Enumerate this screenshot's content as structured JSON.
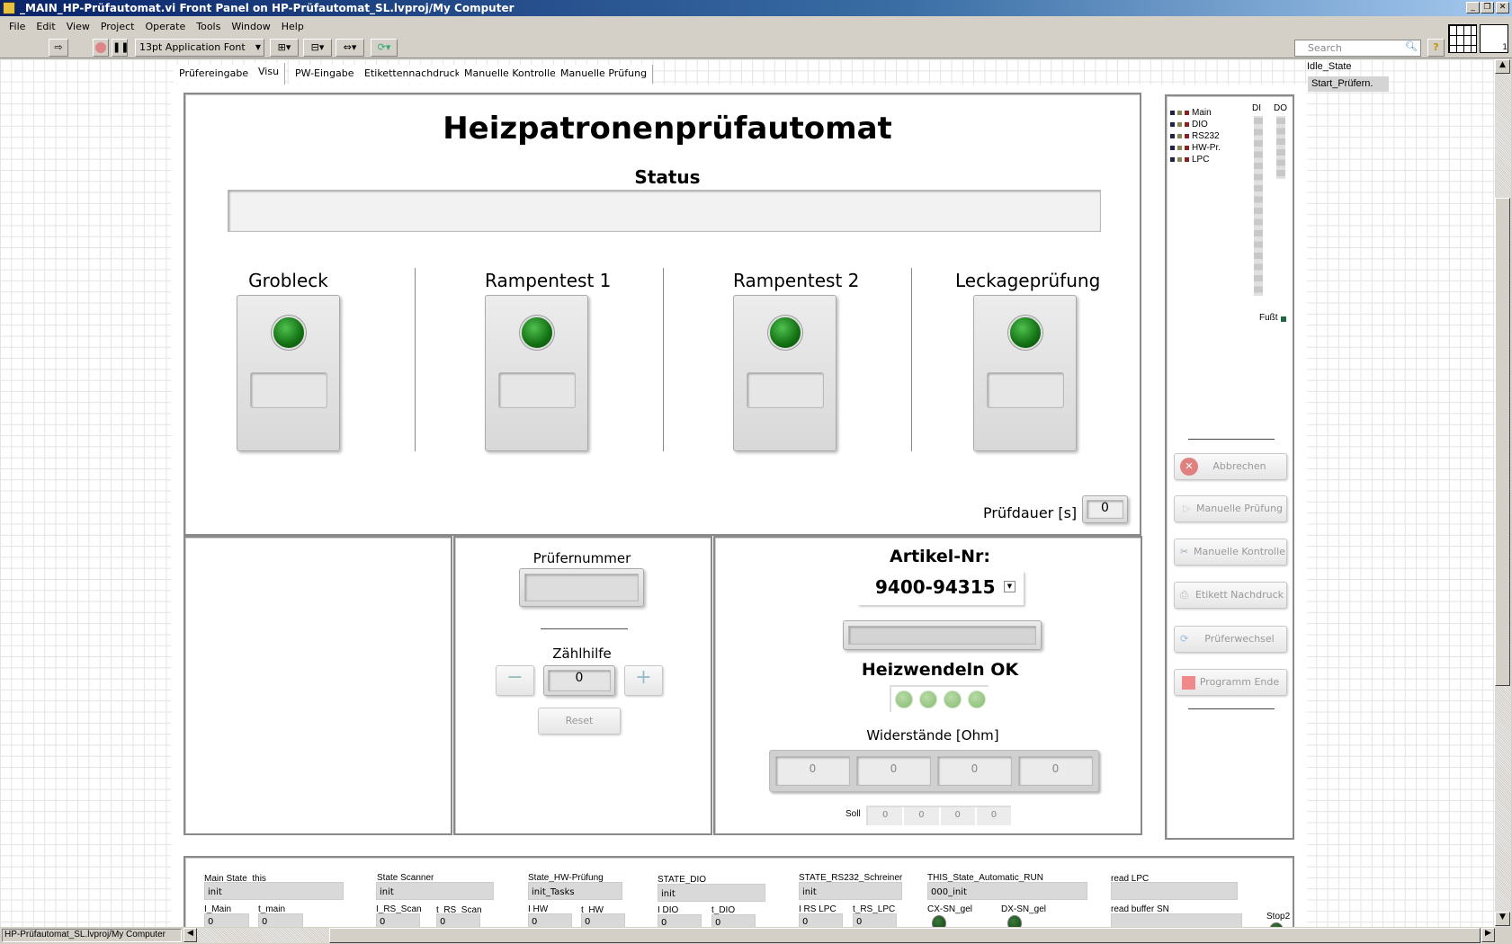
{
  "window": {
    "title": "_MAIN_HP-Prüfautomat.vi Front Panel on HP-Prüfautomat_SL.lvproj/My Computer",
    "controls": [
      "_",
      "❐",
      "✕"
    ]
  },
  "menu": [
    "File",
    "Edit",
    "View",
    "Project",
    "Operate",
    "Tools",
    "Window",
    "Help"
  ],
  "toolbar": {
    "font": "13pt Application Font",
    "search_placeholder": "Search",
    "help": "?",
    "instance": "1"
  },
  "tabs": [
    "Prüfereingabe",
    "Visu",
    "PW-Eingabe",
    "Etikettennachdruck",
    "Manuelle Kontrolle",
    "Manuelle Prüfung"
  ],
  "visu": {
    "title": "Heizpatronenprüfautomat",
    "status_label": "Status",
    "status_value": "",
    "stages": [
      {
        "label": "Grobleck"
      },
      {
        "label": "Rampentest 1"
      },
      {
        "label": "Rampentest 2"
      },
      {
        "label": "Leckageprüfung"
      }
    ],
    "pruefdauer_label": "Prüfdauer [s]",
    "pruefdauer_value": "0",
    "pruefernummer_label": "Prüfernummer",
    "pruefernummer_value": "",
    "zaehlhilfe_label": "Zählhilfe",
    "zaehlhilfe_value": "0",
    "minus": "−",
    "plus": "+",
    "reset": "Reset",
    "artikel_label": "Artikel-Nr:",
    "artikel_value": "9400-94315",
    "artikel_text": "",
    "heizwendeln_label": "Heizwendeln OK",
    "widerstaende_label": "Widerstände [Ohm]",
    "widerstaende": [
      "0",
      "0",
      "0",
      "0"
    ],
    "soll_label": "Soll",
    "soll": [
      "0",
      "0",
      "0",
      "0"
    ]
  },
  "side": {
    "legend": [
      "Main",
      "DIO",
      "RS232",
      "HW-Pr.",
      "LPC"
    ],
    "di_label": "DI",
    "do_label": "DO",
    "fusst_label": "Fußt",
    "buttons": [
      "Abbrechen",
      "Manuelle Prüfung",
      "Manuelle Kontrolle",
      "Etikett Nachdruck",
      "Prüferwechsel",
      "Programm Ende"
    ]
  },
  "states": {
    "idle": "Idle_State",
    "start": "Start_Prüfern."
  },
  "debug": {
    "main_state_label": "Main State_this",
    "main_state": "init",
    "i_main_label": "I_Main",
    "i_main": "0",
    "t_main_label": "t_main",
    "t_main": "0",
    "scanner_label": "State Scanner",
    "scanner": "init",
    "i_rs_scan_label": "I_RS_Scan",
    "i_rs_scan": "0",
    "t_rs_scan_label": "t_RS_Scan",
    "t_rs_scan": "0",
    "hw_label": "State_HW-Prüfung",
    "hw": "init_Tasks",
    "i_hw_label": "I HW",
    "i_hw": "0",
    "t_hw_label": "t_HW",
    "t_hw": "0",
    "dio_label": "STATE_DIO",
    "dio": "init",
    "i_dio_label": "I DIO",
    "i_dio": "0",
    "t_dio_label": "t_DIO",
    "t_dio": "0",
    "rs232_label": "STATE_RS232_Schreiner",
    "rs232": "init",
    "i_rs_lpc_label": "I RS LPC",
    "i_rs_lpc": "0",
    "t_rs_lpc_label": "t_RS_LPC",
    "t_rs_lpc": "0",
    "auto_label": "THIS_State_Automatic_RUN",
    "auto": "000_init",
    "cx_label": "CX-SN_gel",
    "dx_label": "DX-SN_gel",
    "read_lpc_label": "read LPC",
    "read_lpc": "",
    "read_buffer_label": "read buffer SN",
    "read_buffer": "",
    "stop2_label": "Stop2"
  },
  "statusbar": {
    "project": "HP-Prüfautomat_SL.lvproj/My Computer"
  }
}
